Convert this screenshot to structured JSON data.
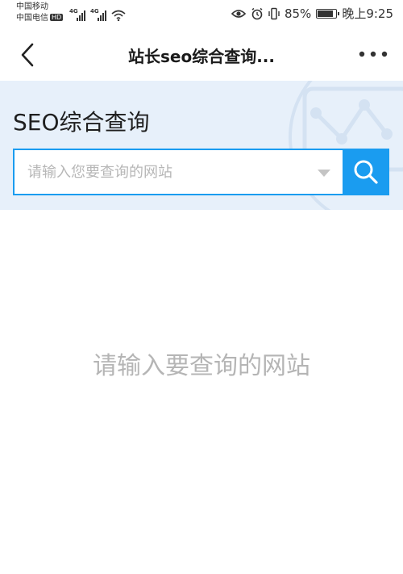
{
  "status_bar": {
    "carrier_1": "中国移动",
    "carrier_2": "中国电信",
    "hd_badge": "HD",
    "network_1": "4G",
    "network_2": "4G",
    "battery_percent": "85%",
    "battery_level": 0.85,
    "time": "晚上9:25"
  },
  "nav": {
    "title": "站长seo综合查询...",
    "more_label": "•••"
  },
  "hero": {
    "title": "SEO综合查询"
  },
  "search": {
    "placeholder": "请输入您要查询的网站",
    "value": ""
  },
  "empty_state": {
    "hint": "请输入要查询的网站"
  },
  "colors": {
    "accent": "#1a9cf0",
    "hero_bg": "#e7f0fa",
    "hint_text": "#b5b5b5"
  },
  "icons": {
    "back": "chevron-left-icon",
    "more": "more-dots-icon",
    "search": "search-icon",
    "dropdown": "caret-down-icon"
  }
}
